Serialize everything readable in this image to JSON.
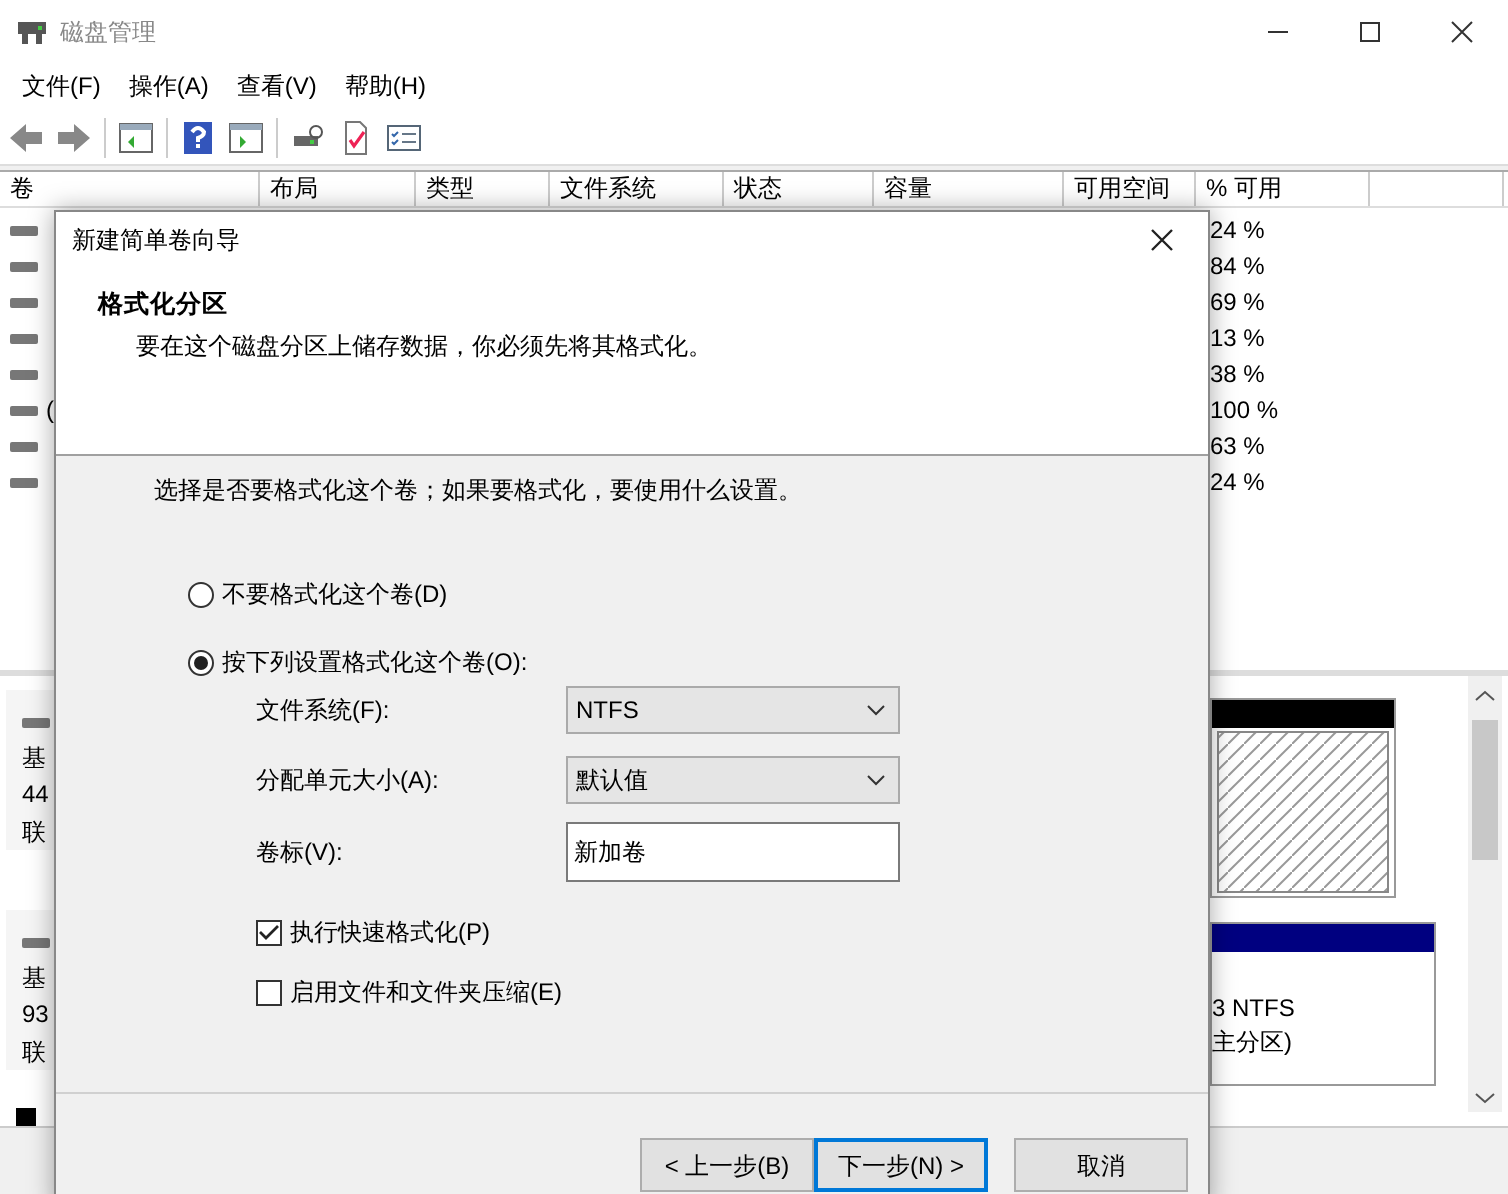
{
  "window": {
    "title": "磁盘管理"
  },
  "menu": [
    "文件(F)",
    "操作(A)",
    "查看(V)",
    "帮助(H)"
  ],
  "table": {
    "columns": [
      "卷",
      "布局",
      "类型",
      "文件系统",
      "状态",
      "容量",
      "可用空间",
      "% 可用"
    ],
    "rows": [
      {
        "percent_free": "24 %"
      },
      {
        "percent_free": "84 %"
      },
      {
        "percent_free": "69 %"
      },
      {
        "percent_free": "13 %"
      },
      {
        "percent_free": "38 %"
      },
      {
        "volume": "(",
        "percent_free": "100 %"
      },
      {
        "percent_free": "63 %"
      },
      {
        "percent_free": "24 %"
      }
    ]
  },
  "disks": [
    {
      "label_lines": [
        "基",
        "44",
        "联"
      ]
    },
    {
      "label_lines": [
        "基",
        "93",
        "联"
      ]
    }
  ],
  "partitions": [
    {
      "kind": "unallocated"
    },
    {
      "kind": "primary",
      "lines": [
        "3 NTFS",
        "主分区)"
      ]
    }
  ],
  "dialog": {
    "title": "新建简单卷向导",
    "heading": "格式化分区",
    "subheading": "要在这个磁盘分区上储存数据，你必须先将其格式化。",
    "prompt": "选择是否要格式化这个卷；如果要格式化，要使用什么设置。",
    "options": [
      {
        "label": "不要格式化这个卷(D)",
        "selected": false
      },
      {
        "label": "按下列设置格式化这个卷(O):",
        "selected": true
      }
    ],
    "fields": [
      {
        "kind": "select",
        "label": "文件系统(F):",
        "value": "NTFS"
      },
      {
        "kind": "select",
        "label": "分配单元大小(A):",
        "value": "默认值"
      },
      {
        "kind": "text",
        "label": "卷标(V):",
        "value": "新加卷"
      }
    ],
    "checkboxes": [
      {
        "label": "执行快速格式化(P)",
        "checked": true
      },
      {
        "label": "启用文件和文件夹压缩(E)",
        "checked": false
      }
    ],
    "buttons": [
      {
        "label": "< 上一步(B)",
        "default": false
      },
      {
        "label": "下一步(N) >",
        "default": true
      },
      {
        "label": "取消",
        "default": false
      }
    ]
  }
}
